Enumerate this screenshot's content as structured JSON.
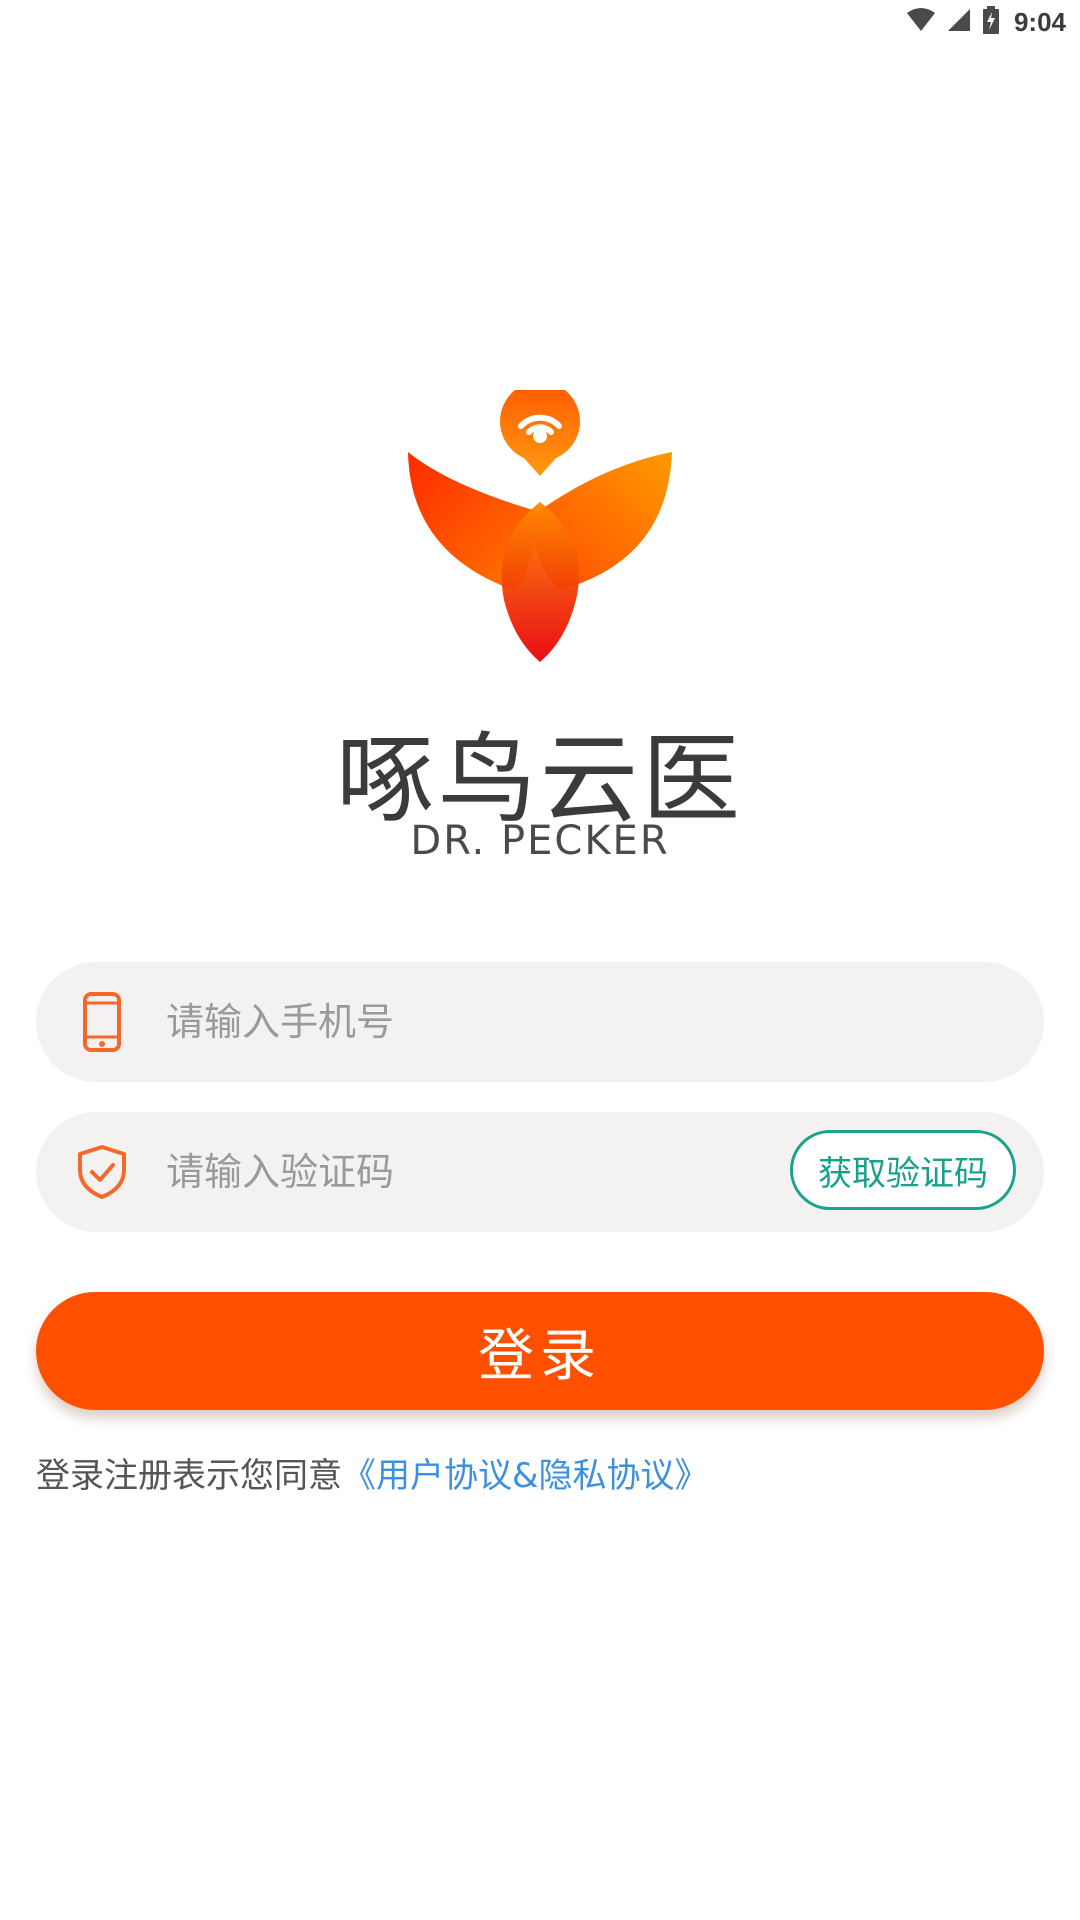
{
  "status_bar": {
    "time": "9:04",
    "icons": [
      "wifi-icon",
      "cell-signal-icon",
      "battery-charging-icon"
    ]
  },
  "brand": {
    "name": "啄鸟云医",
    "subtitle": "DR. PECKER",
    "logo_colors": [
      "#ff3b00",
      "#ff8a00",
      "#e00010"
    ]
  },
  "phone_field": {
    "icon": "phone-icon",
    "placeholder": "请输入手机号",
    "value": ""
  },
  "code_field": {
    "icon": "shield-check-icon",
    "placeholder": "请输入验证码",
    "value": "",
    "get_code_label": "获取验证码"
  },
  "login_button": {
    "label": "登录"
  },
  "agreement": {
    "prefix": "登录注册表示您同意",
    "link": "《用户协议&隐私协议》"
  },
  "colors": {
    "primary": "#ff5000",
    "accent_green": "#17a08a",
    "link_blue": "#3d8fe0",
    "field_bg": "#f3f2f1"
  }
}
